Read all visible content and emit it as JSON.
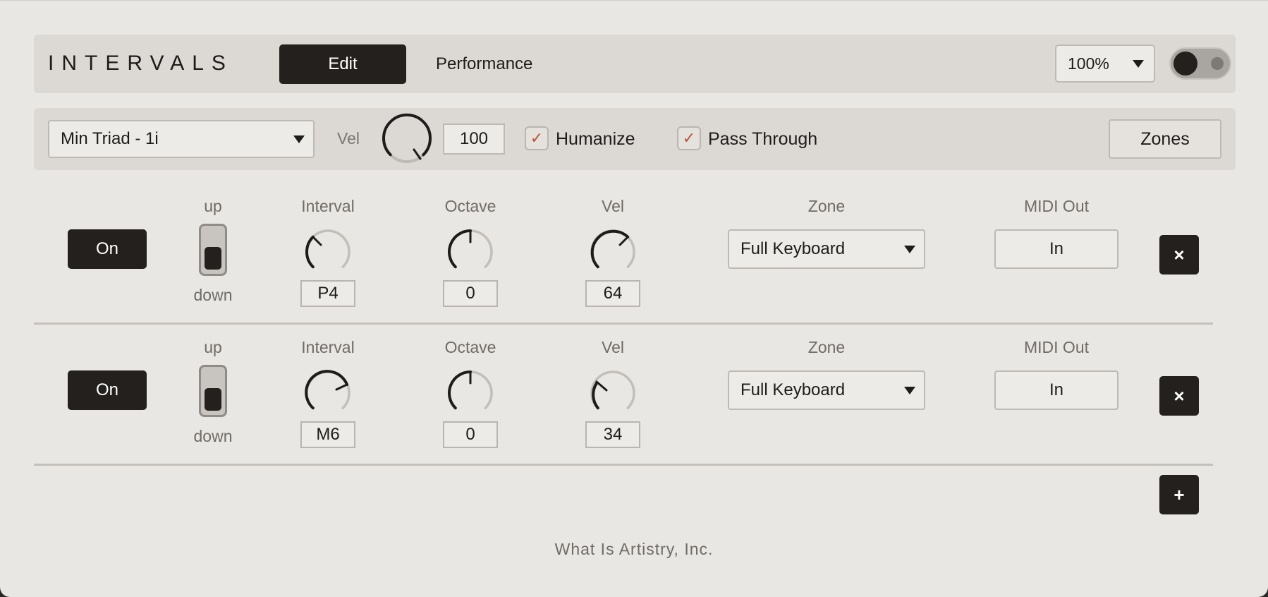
{
  "header": {
    "brand": "INTERVALS",
    "tabs": {
      "edit": "Edit",
      "performance": "Performance"
    },
    "zoom": "100%"
  },
  "controls": {
    "preset": "Min Triad - 1i",
    "vel_label": "Vel",
    "vel_value": "100",
    "humanize": {
      "label": "Humanize",
      "checked": true
    },
    "pass_through": {
      "label": "Pass Through",
      "checked": true
    },
    "zones_button": "Zones"
  },
  "columns": {
    "up": "up",
    "down": "down",
    "interval": "Interval",
    "octave": "Octave",
    "vel": "Vel",
    "zone": "Zone",
    "midi_out": "MIDI Out"
  },
  "rows": [
    {
      "on": "On",
      "interval": "P4",
      "octave": "0",
      "vel": "64",
      "zone": "Full Keyboard",
      "midi_out": "In",
      "delete_icon": "×"
    },
    {
      "on": "On",
      "interval": "M6",
      "octave": "0",
      "vel": "34",
      "zone": "Full Keyboard",
      "midi_out": "In",
      "delete_icon": "×"
    }
  ],
  "add_icon": "+",
  "footer": "What Is Artistry, Inc.",
  "colors": {
    "dark": "#23201e",
    "check": "#b8553a",
    "panel": "#dcd9d5",
    "background": "#e9e7e3"
  }
}
